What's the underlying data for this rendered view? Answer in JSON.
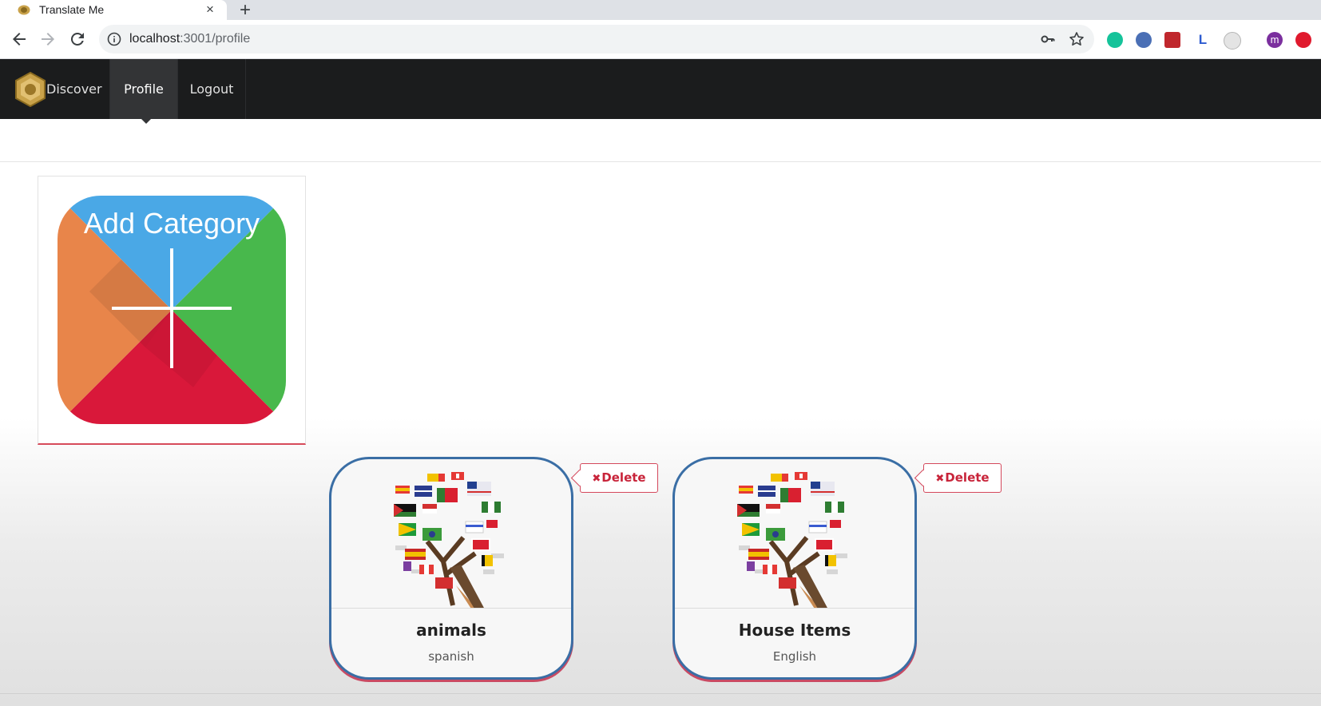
{
  "browser": {
    "tab_title": "Translate Me",
    "tab_close": "×",
    "new_tab": "+",
    "url_host": "localhost",
    "url_path": ":3001/profile",
    "extensions": [
      {
        "icon": "grammarly-icon",
        "color": "#15c39a"
      },
      {
        "icon": "extension-icon-blue",
        "color": "#4a6fb5"
      },
      {
        "icon": "extension-icon-red",
        "color": "#c0272d"
      },
      {
        "icon": "extension-icon-l",
        "color": "#2d5bd0"
      },
      {
        "icon": "extension-icon-grey",
        "color": "#b5b5b5"
      },
      {
        "icon": "profile-avatar",
        "letter": "m",
        "color": "#7b2f9e"
      },
      {
        "icon": "extension-icon-alert",
        "color": "#e0192d"
      }
    ]
  },
  "navbar": {
    "items": [
      {
        "label": "Discover"
      },
      {
        "label": "Profile",
        "active": true
      },
      {
        "label": "Logout"
      }
    ]
  },
  "add_category": {
    "label": "Add Category"
  },
  "categories": [
    {
      "name": "animals",
      "language": "spanish",
      "delete_label": "Delete"
    },
    {
      "name": "House Items",
      "language": "English",
      "delete_label": "Delete"
    }
  ],
  "colors": {
    "navbar_bg": "#1b1c1d",
    "card_border": "#3a6ea5",
    "delete_red": "#c8243a",
    "tile_blue": "#4aa8e6",
    "tile_green": "#48b84c",
    "tile_orange": "#e8854a",
    "tile_red": "#d9183a"
  }
}
